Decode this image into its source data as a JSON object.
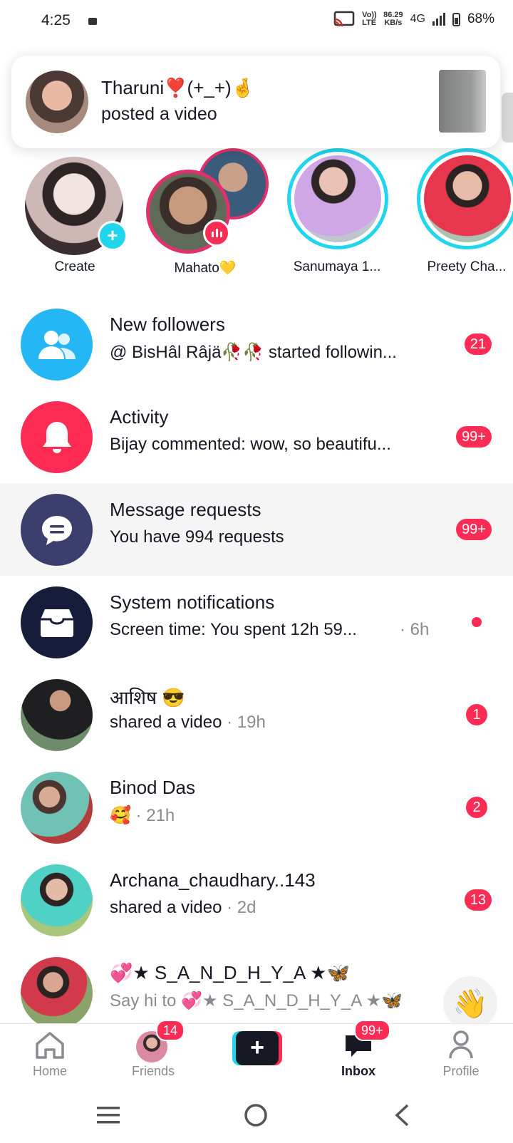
{
  "status_bar": {
    "time": "4:25",
    "net_top": "Vo)) LTE",
    "speed_value": "86.29",
    "speed_unit": "KB/s",
    "network": "4G",
    "battery": "68%"
  },
  "notification": {
    "name": "Tharuni❣️(+_+)🤞",
    "action": "posted a video"
  },
  "stories": [
    {
      "label": "Create"
    },
    {
      "label": "Mahato💛"
    },
    {
      "label": "Sanumaya 1..."
    },
    {
      "label": "Preety Cha..."
    }
  ],
  "rows": [
    {
      "title": "New followers",
      "subtitle": "@ BisHâl Râjä🥀🥀 started followin...",
      "badge": "21",
      "color": "#25b7f5"
    },
    {
      "title": "Activity",
      "subtitle": "Bijay commented: wow, so beautifu...",
      "badge": "99+",
      "color": "#fe2c55"
    },
    {
      "title": "Message requests",
      "subtitle": "You have 994 requests",
      "badge": "99+",
      "color": "#3c3f6e"
    },
    {
      "title": "System notifications",
      "subtitle": "Screen time: You spent 12h 59...",
      "time": "· 6h",
      "color": "#161d3a"
    },
    {
      "title": "आशिष 😎",
      "subtitle": "shared a video",
      "time": " · 19h",
      "badge": "1"
    },
    {
      "title": "Binod Das",
      "subtitle": "🥰",
      "time": " · 21h",
      "badge": "2"
    },
    {
      "title": "Archana_chaudhary..143",
      "subtitle": "shared a video",
      "time": " · 2d",
      "badge": "13"
    },
    {
      "title": "💞★ S_A_N_D_H_Y_A ★🦋",
      "subtitle": "Say hi to 💞★ S_A_N_D_H_Y_A ★🦋"
    }
  ],
  "tabs": {
    "home": "Home",
    "friends": "Friends",
    "friends_badge": "14",
    "inbox": "Inbox",
    "inbox_badge": "99+",
    "profile": "Profile",
    "create": "+"
  }
}
